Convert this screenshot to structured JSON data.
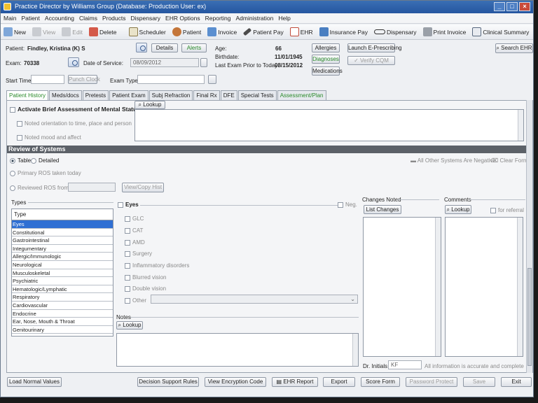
{
  "window": {
    "title": "Practice Director by Williams Group  (Database: Production  User: ex)"
  },
  "menu": [
    "Main",
    "Patient",
    "Accounting",
    "Claims",
    "Products",
    "Dispensary",
    "EHR Options",
    "Reporting",
    "Administration",
    "Help"
  ],
  "toolbar": [
    {
      "label": "New",
      "icon": "new-icon",
      "disabled": false
    },
    {
      "label": "View",
      "icon": "view-icon",
      "disabled": true
    },
    {
      "label": "Edit",
      "icon": "edit-icon",
      "disabled": true
    },
    {
      "label": "Delete",
      "icon": "delete-icon",
      "disabled": false
    },
    {
      "label": "Scheduler",
      "icon": "calendar-icon",
      "disabled": false
    },
    {
      "label": "Patient",
      "icon": "patient-icon",
      "disabled": false
    },
    {
      "label": "Invoice",
      "icon": "invoice-icon",
      "disabled": false
    },
    {
      "label": "Patient Pay",
      "icon": "pen-icon",
      "disabled": false
    },
    {
      "label": "EHR",
      "icon": "ehr-icon",
      "disabled": false
    },
    {
      "label": "Insurance Pay",
      "icon": "insurance-icon",
      "disabled": false
    },
    {
      "label": "Dispensary",
      "icon": "glasses-icon",
      "disabled": false
    },
    {
      "label": "Print Invoice",
      "icon": "printer-icon",
      "disabled": false
    },
    {
      "label": "Clinical Summary",
      "icon": "summary-icon",
      "disabled": false
    }
  ],
  "patient": {
    "label": "Patient:",
    "name": "Findley, Kristina (K) S",
    "details_btn": "Details",
    "alerts_btn": "Alerts",
    "age_label": "Age:",
    "age": "66",
    "birthdate_label": "Birthdate:",
    "birthdate": "11/01/1945",
    "last_exam_label": "Last Exam Prior to Today:",
    "last_exam": "08/15/2012"
  },
  "exam": {
    "label": "Exam:",
    "number": "70338",
    "dos_label": "Date of Service:",
    "dos": "08/09/2012",
    "start_time_label": "Start Time",
    "punch_clock": "Punch Clock",
    "exam_type_label": "Exam Type"
  },
  "side_buttons": {
    "allergies": "Allergies",
    "diagnoses": "Diagnoses",
    "medications": "Medications",
    "launch_erx": "Launch E-Prescribing",
    "verify_cqm": "Verify CQM",
    "search_ehr": "Search EHR"
  },
  "tabs": [
    "Patient History",
    "Meds/docs",
    "Pretests",
    "Patient Exam",
    "Subj Refraction",
    "Final Rx",
    "DFE",
    "Special Tests",
    "Assessment/Plan"
  ],
  "mental_status": {
    "title": "Activate Brief Assessment of Mental Status",
    "lookup": "Lookup",
    "items": [
      "Noted orientation to time, place and person",
      "Noted mood and affect"
    ]
  },
  "ros": {
    "header": "Review of Systems",
    "table_label": "Table",
    "detailed_label": "Detailed",
    "all_negative": "All Other Systems Are Negative",
    "clear_form": "Clear Form",
    "primary_label": "Primary ROS taken today",
    "reviewed_label": "Reviewed ROS from:",
    "view_copy": "View/Copy Hist"
  },
  "types": {
    "label": "Types",
    "header": "Type",
    "rows": [
      "Eyes",
      "Constitutional",
      "Gastrointestinal",
      "Integumentary",
      "Allergic/Immunologic",
      "Neurological",
      "Musculoskeletal",
      "Psychiatric",
      "Hematologic/Lymphatic",
      "Respiratory",
      "Cardiovascular",
      "Endocrine",
      "Ear, Nose, Mouth & Throat",
      "Genitourinary"
    ],
    "selected": 0
  },
  "eyes": {
    "title": "Eyes",
    "neg": "Neg.",
    "items": [
      "GLC",
      "CAT",
      "AMD",
      "Surgery",
      "Inflammatory disorders",
      "Blurred vision",
      "Double vision",
      "Other"
    ]
  },
  "notes": {
    "label": "Notes",
    "lookup": "Lookup"
  },
  "changes": {
    "label": "Changes Noted",
    "list_changes": "List Changes"
  },
  "comments": {
    "label": "Comments",
    "lookup": "Lookup",
    "for_referral": "for referral"
  },
  "initials": {
    "label": "Dr. Initials",
    "value": "KF",
    "note": "All information is accurate and complete"
  },
  "bottom": {
    "load_normal": "Load Normal Values",
    "decision_support": "Decision Support Rules",
    "view_encryption": "View Encryption Code",
    "ehr_report": "EHR Report",
    "export": "Export",
    "score_form": "Score Form",
    "password_protect": "Password Protect",
    "save": "Save",
    "exit": "Exit"
  },
  "colors": {
    "titlebar": "#2556a0",
    "selected_row": "#2f6fd3",
    "green_text": "#2a8a2a",
    "section_header": "#5c6168"
  }
}
